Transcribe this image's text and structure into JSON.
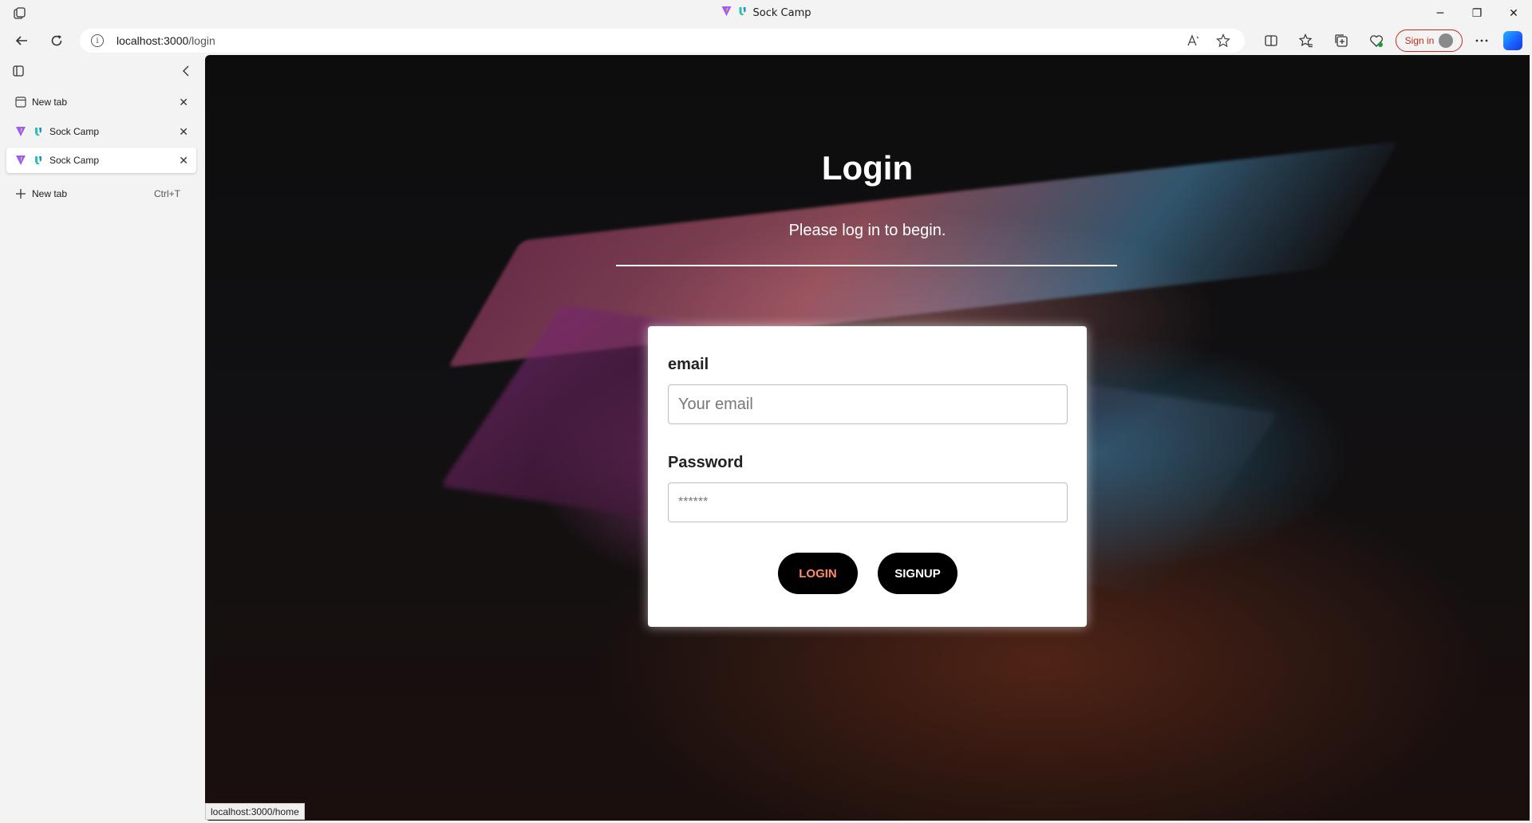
{
  "window": {
    "title": "Sock Camp",
    "controls": {
      "minimize": "─",
      "restore": "❐",
      "close": "✕"
    }
  },
  "toolbar": {
    "url_host": "localhost:3000",
    "url_path": "/login",
    "signin_label": "Sign in"
  },
  "sidebar": {
    "tabs": [
      {
        "label": "New tab",
        "icon": "new-tab-page-icon",
        "active": false
      },
      {
        "label": "Sock Camp",
        "icon": "vite-logo-icon",
        "active": false
      },
      {
        "label": "Sock Camp",
        "icon": "vite-logo-icon",
        "active": true
      }
    ],
    "new_tab_label": "New tab",
    "new_tab_shortcut": "Ctrl+T"
  },
  "page": {
    "title": "Login",
    "subtitle": "Please log in to begin.",
    "email_label": "email",
    "email_placeholder": "Your email",
    "password_label": "Password",
    "password_placeholder": "******",
    "login_button": "LOGIN",
    "signup_button": "SIGNUP"
  },
  "status_bar": {
    "link_preview": "localhost:3000/home"
  },
  "colors": {
    "login_text": "#ff8c69",
    "signin_accent": "#c42b1c",
    "button_bg": "#000000"
  }
}
